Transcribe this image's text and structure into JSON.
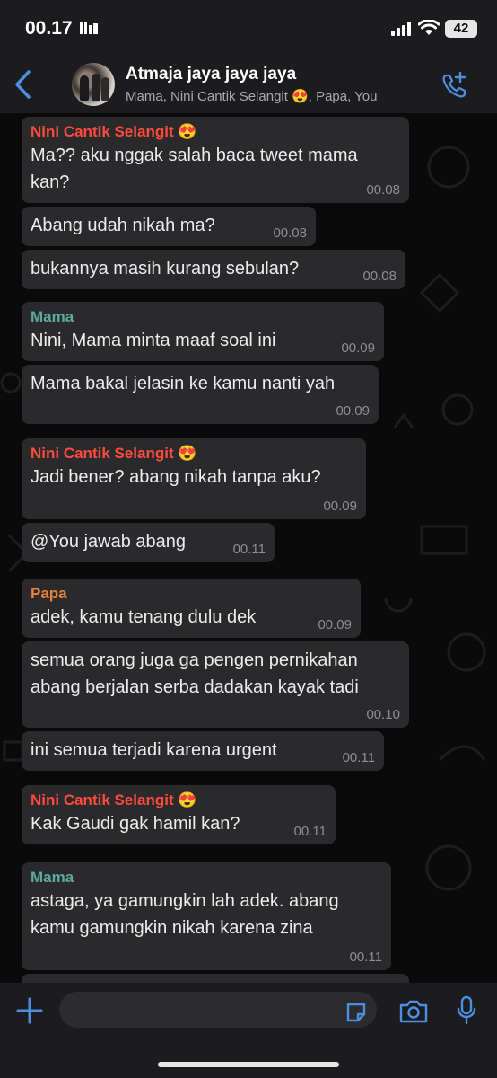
{
  "status_bar": {
    "time": "00.17",
    "battery": "42"
  },
  "header": {
    "title": "Atmaja jaya jaya jaya",
    "subtitle": "Mama, Nini Cantik Selangit 😍, Papa, You"
  },
  "colors": {
    "nini": "#ff4a3d",
    "mama": "#5ea89c",
    "papa": "#e8823a",
    "accent": "#4a8fe0"
  },
  "messages": [
    {
      "sender": "Nini Cantik Selangit 😍",
      "text": "Ma?? aku nggak salah baca tweet mama kan?",
      "time": "00.08"
    },
    {
      "sender": "",
      "text": "Abang udah nikah ma?",
      "time": "00.08"
    },
    {
      "sender": "",
      "text": "bukannya masih kurang sebulan?",
      "time": "00.08"
    },
    {
      "sender": "Mama",
      "text": "Nini, Mama minta maaf soal ini",
      "time": "00.09"
    },
    {
      "sender": "",
      "text": "Mama bakal jelasin ke kamu nanti yah",
      "time": "00.09"
    },
    {
      "sender": "Nini Cantik Selangit 😍",
      "text": "Jadi bener? abang nikah tanpa aku?",
      "time": "00.09"
    },
    {
      "sender": "",
      "text": "@You jawab abang",
      "time": "00.11"
    },
    {
      "sender": "Papa",
      "text": "adek, kamu tenang dulu dek",
      "time": "00.09"
    },
    {
      "sender": "",
      "text": "semua orang juga ga pengen pernikahan abang berjalan serba dadakan kayak tadi",
      "time": "00.10"
    },
    {
      "sender": "",
      "text": "ini semua terjadi karena urgent",
      "time": "00.11"
    },
    {
      "sender": "Nini Cantik Selangit 😍",
      "text": "Kak Gaudi gak hamil kan?",
      "time": "00.11"
    },
    {
      "sender": "Mama",
      "text": "astaga, ya gamungkin lah adek. abang kamu gamungkin nikah karena zina",
      "time": "00.11"
    }
  ],
  "icons": {
    "back": "chevron-left-icon",
    "call": "add-call-icon",
    "plus": "plus-icon",
    "sticker": "sticker-icon",
    "camera": "camera-icon",
    "mic": "microphone-icon"
  }
}
